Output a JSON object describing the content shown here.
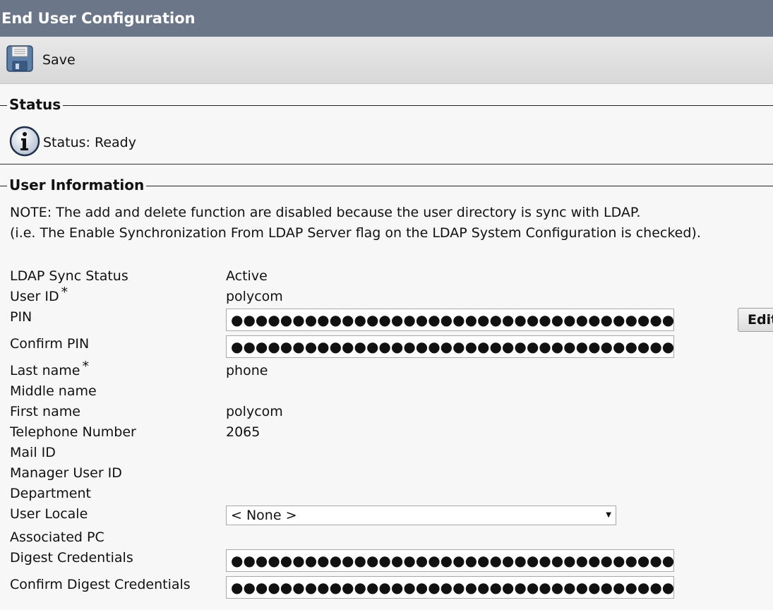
{
  "window": {
    "title": "End User Configuration"
  },
  "toolbar": {
    "save_label": "Save",
    "save_icon": "floppy-disk-icon"
  },
  "status_section": {
    "legend": "Status",
    "icon": "info-icon",
    "text": "Status: Ready"
  },
  "user_info": {
    "legend": "User Information",
    "note_line1": "NOTE: The add and delete function are disabled because the user directory is sync with LDAP.",
    "note_line2": "(i.e. The Enable Synchronization From LDAP Server flag on the LDAP System Configuration is checked).",
    "required_marker": "*",
    "fields": {
      "ldap_sync_status": {
        "label": "LDAP Sync Status",
        "value": "Active"
      },
      "user_id": {
        "label": "User ID",
        "value": "polycom"
      },
      "pin": {
        "label": "PIN",
        "value": "●●●●●●●●●●●●●●●●●●●●●●●●●●●●●●●●●●●●●●●●"
      },
      "confirm_pin": {
        "label": "Confirm PIN",
        "value": "●●●●●●●●●●●●●●●●●●●●●●●●●●●●●●●●●●●●●●●●"
      },
      "last_name": {
        "label": "Last name",
        "value": "phone"
      },
      "middle_name": {
        "label": "Middle name",
        "value": ""
      },
      "first_name": {
        "label": "First name",
        "value": "polycom"
      },
      "telephone_number": {
        "label": "Telephone Number",
        "value": "2065"
      },
      "mail_id": {
        "label": "Mail ID",
        "value": ""
      },
      "manager_user_id": {
        "label": "Manager User ID",
        "value": ""
      },
      "department": {
        "label": "Department",
        "value": ""
      },
      "user_locale": {
        "label": "User Locale",
        "value": "< None >"
      },
      "associated_pc": {
        "label": "Associated PC",
        "value": ""
      },
      "digest_credentials": {
        "label": "Digest Credentials",
        "value": "●●●●●●●●●●●●●●●●●●●●●●●●●●●●●●●●●●●●●●●●●●●●●●●●●●●●●●●●●●"
      },
      "confirm_digest_credentials": {
        "label": "Confirm Digest Credentials",
        "value": "●●●●●●●●●●●●●●●●●●●●●●●●●●●●●●●●●●●●●●●●●●●●●●●●●●●●●●●●●●"
      }
    },
    "edit_button": "Edit"
  }
}
